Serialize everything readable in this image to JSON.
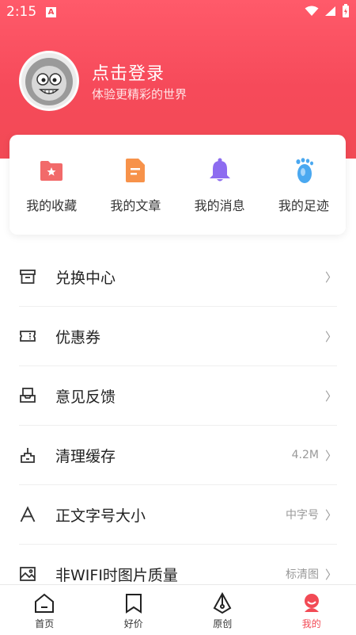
{
  "status_bar": {
    "time": "2:15",
    "notification_badge": "A"
  },
  "profile": {
    "title": "点击登录",
    "subtitle": "体验更精彩的世界"
  },
  "quick_links": [
    {
      "label": "我的收藏",
      "icon": "folder-star-icon"
    },
    {
      "label": "我的文章",
      "icon": "document-icon"
    },
    {
      "label": "我的消息",
      "icon": "bell-icon"
    },
    {
      "label": "我的足迹",
      "icon": "footprint-icon"
    }
  ],
  "menu": [
    {
      "label": "兑换中心",
      "value": "",
      "icon": "archive-box-icon"
    },
    {
      "label": "优惠券",
      "value": "",
      "icon": "ticket-icon"
    },
    {
      "label": "意见反馈",
      "value": "",
      "icon": "inbox-icon"
    },
    {
      "label": "清理缓存",
      "value": "4.2M",
      "icon": "broom-icon"
    },
    {
      "label": "正文字号大小",
      "value": "中字号",
      "icon": "font-size-icon"
    },
    {
      "label": "非WIFI时图片质量",
      "value": "标清图",
      "icon": "image-icon"
    }
  ],
  "tabs": [
    {
      "label": "首页",
      "icon": "home-icon",
      "active": false
    },
    {
      "label": "好价",
      "icon": "bookmark-icon",
      "active": false
    },
    {
      "label": "原创",
      "icon": "pen-nib-icon",
      "active": false
    },
    {
      "label": "我的",
      "icon": "profile-icon",
      "active": true
    }
  ],
  "colors": {
    "accent": "#f24a55",
    "header_top": "#ff5a6a"
  }
}
